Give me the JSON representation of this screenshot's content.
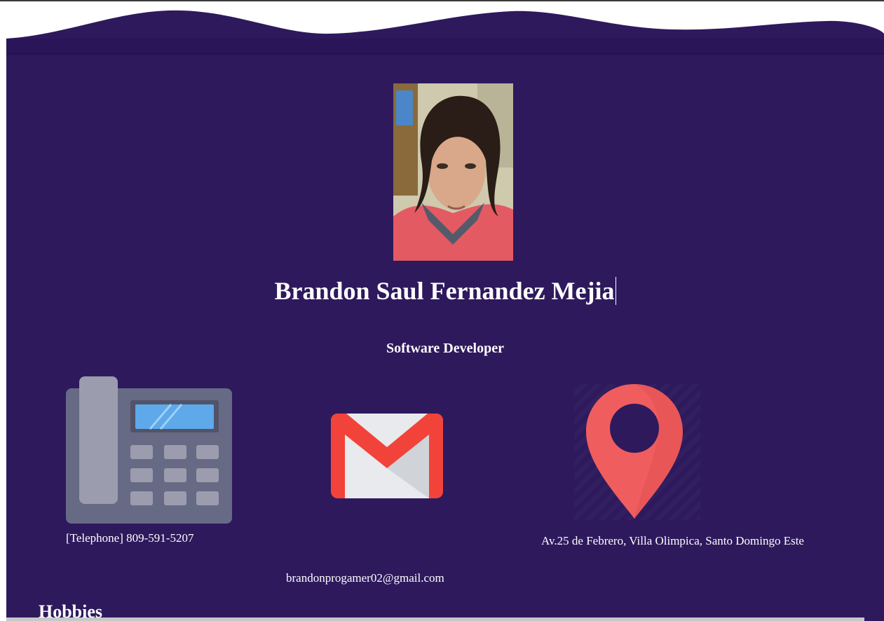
{
  "profile": {
    "name": "Brandon Saul Fernandez Mejia",
    "title": "Software Developer"
  },
  "contact": {
    "telephone": "[Telephone] 809-591-5207",
    "email": "brandonprogamer02@gmail.com",
    "address": "Av.25 de Febrero, Villa Olimpica, Santo Domingo Este"
  },
  "sections": {
    "hobbies_heading": "Hobbies"
  },
  "icons": {
    "phone": "telephone-icon",
    "mail": "gmail-icon",
    "location": "map-pin-icon"
  },
  "colors": {
    "background": "#2e195d",
    "banner": "#2e195d",
    "text": "#ffffff",
    "pin": "#f05d5e",
    "gmail_red": "#ea4335"
  }
}
